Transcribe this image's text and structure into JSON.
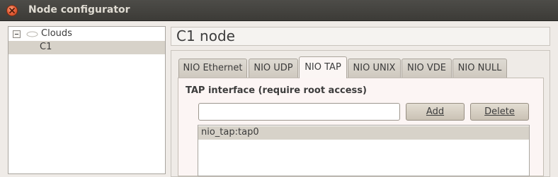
{
  "window": {
    "title": "Node configurator"
  },
  "tree": {
    "root_label": "Clouds",
    "children": [
      {
        "label": "C1",
        "selected": true
      }
    ]
  },
  "node": {
    "title": "C1 node"
  },
  "tabs": [
    {
      "label": "NIO Ethernet",
      "active": false
    },
    {
      "label": "NIO UDP",
      "active": false
    },
    {
      "label": "NIO TAP",
      "active": true
    },
    {
      "label": "NIO UNIX",
      "active": false
    },
    {
      "label": "NIO VDE",
      "active": false
    },
    {
      "label": "NIO NULL",
      "active": false
    }
  ],
  "tap": {
    "section_label": "TAP interface (require root access)",
    "input_value": "",
    "add_label": "Add",
    "delete_label": "Delete",
    "items": [
      {
        "label": "nio_tap:tap0",
        "selected": true
      }
    ]
  },
  "colors": {
    "titlebar": "#3c3b37",
    "close_button": "#e8603a",
    "selection": "#d7d2c9",
    "panel": "#fcf5f4"
  }
}
